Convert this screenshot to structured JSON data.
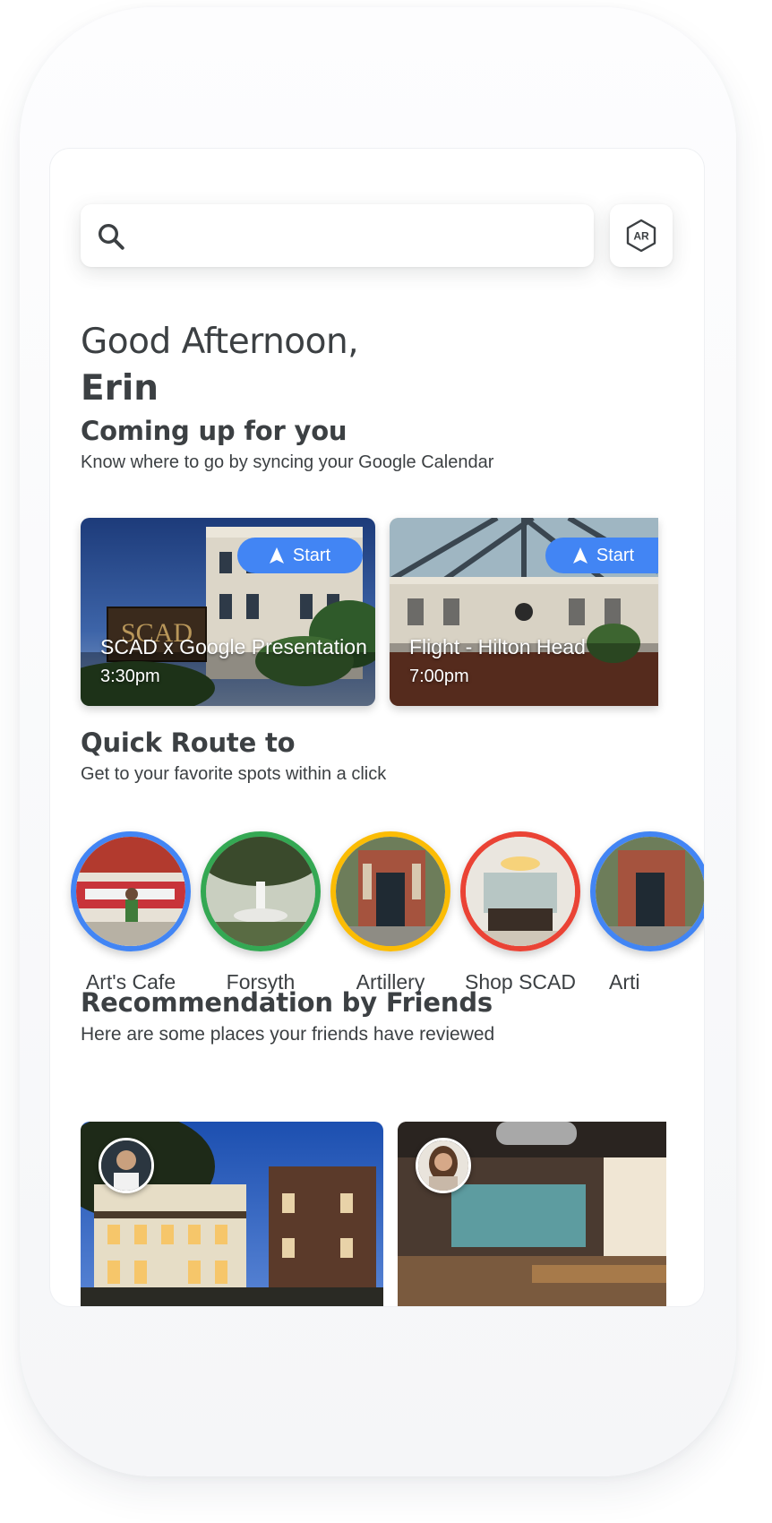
{
  "search": {
    "placeholder": "",
    "value": "",
    "ar_label": "AR"
  },
  "greeting": {
    "line1": "Good Afternoon,",
    "name": "Erin"
  },
  "coming_up": {
    "title": "Coming up for you",
    "subtitle": "Know where to go by syncing your Google Calendar",
    "start_label": "Start",
    "events": [
      {
        "title": "SCAD x Google Presentation",
        "time": "3:30pm"
      },
      {
        "title": "Flight - Hilton Head",
        "time": "7:00pm"
      }
    ]
  },
  "quick_route": {
    "title": "Quick Route to",
    "subtitle": "Get to your favorite spots within a click",
    "places": [
      {
        "label": "Art's Cafe",
        "ring_color": "#4285f4"
      },
      {
        "label": "Forsyth",
        "ring_color": "#34a853"
      },
      {
        "label": "Artillery",
        "ring_color": "#fbbc04"
      },
      {
        "label": "Shop SCAD",
        "ring_color": "#ea4335"
      },
      {
        "label": "Arti",
        "ring_color": "#4285f4"
      }
    ]
  },
  "friends": {
    "title": "Recommendation by Friends",
    "subtitle": "Here are some places your friends have reviewed"
  },
  "colors": {
    "accent_blue": "#4285f4",
    "green": "#34a853",
    "yellow": "#fbbc04",
    "red": "#ea4335",
    "text": "#3c4043"
  }
}
